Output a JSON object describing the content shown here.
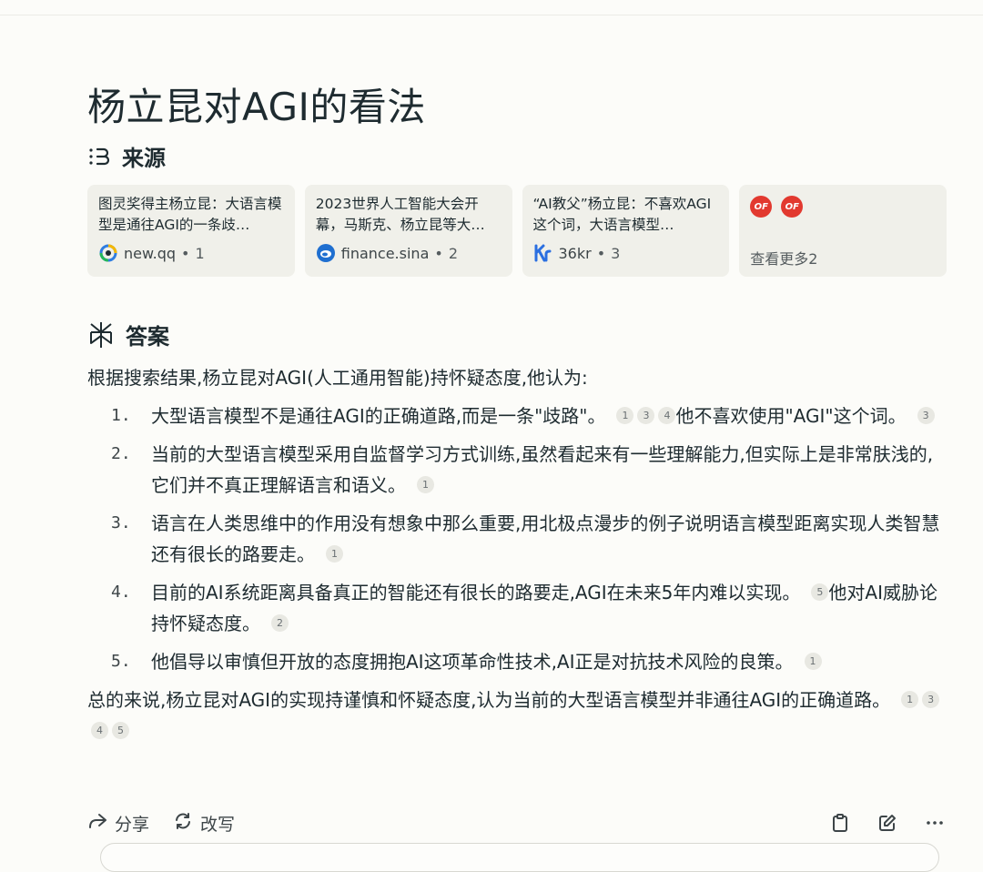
{
  "title": "杨立昆对AGI的看法",
  "sources": {
    "heading": "来源",
    "cards": [
      {
        "title": "图灵奖得主杨立昆：大语言模型是通往AGI的一条歧…",
        "domain": "new.qq",
        "index": "1",
        "icon": "qq-news-icon"
      },
      {
        "title": "2023世界人工智能大会开幕，马斯克、杨立昆等大…",
        "domain": "finance.sina",
        "index": "2",
        "icon": "sina-icon"
      },
      {
        "title": "“AI教父”杨立昆：不喜欢AGI这个词，大语言模型…",
        "domain": "36kr",
        "index": "3",
        "icon": "36kr-icon"
      }
    ],
    "more": {
      "label": "查看更多2",
      "icons": [
        "OF",
        "OF"
      ]
    }
  },
  "answer": {
    "heading": "答案",
    "intro": "根据搜索结果,杨立昆对AGI(人工通用智能)持怀疑态度,他认为:",
    "points": [
      {
        "num": "1.",
        "parts": [
          {
            "text": "大型语言模型不是通往AGI的正确道路,而是一条\"歧路\"。",
            "cites": [
              "1",
              "3",
              "4"
            ]
          },
          {
            "text": "他不喜欢使用\"AGI\"这个词。",
            "cites": [
              "3"
            ]
          }
        ]
      },
      {
        "num": "2.",
        "parts": [
          {
            "text": "当前的大型语言模型采用自监督学习方式训练,虽然看起来有一些理解能力,但实际上是非常肤浅的,它们并不真正理解语言和语义。",
            "cites": [
              "1"
            ]
          }
        ]
      },
      {
        "num": "3.",
        "parts": [
          {
            "text": "语言在人类思维中的作用没有想象中那么重要,用北极点漫步的例子说明语言模型距离实现人类智慧还有很长的路要走。",
            "cites": [
              "1"
            ]
          }
        ]
      },
      {
        "num": "4.",
        "parts": [
          {
            "text": "目前的AI系统距离具备真正的智能还有很长的路要走,AGI在未来5年内难以实现。",
            "cites": [
              "5"
            ]
          },
          {
            "text": "他对AI威胁论持怀疑态度。",
            "cites": [
              "2"
            ]
          }
        ]
      },
      {
        "num": "5.",
        "parts": [
          {
            "text": "他倡导以审慎但开放的态度拥抱AI这项革命性技术,AI正是对抗技术风险的良策。",
            "cites": [
              "1"
            ]
          }
        ]
      }
    ],
    "summary": {
      "text": "总的来说,杨立昆对AGI的实现持谨慎和怀疑态度,认为当前的大型语言模型并非通往AGI的正确道路。",
      "cites": [
        "1",
        "3",
        "4",
        "5"
      ]
    }
  },
  "actions": {
    "share": "分享",
    "rewrite": "改写"
  },
  "colors": {
    "background": "#fcfcf9",
    "card": "#f0f0ea",
    "text": "#1e2b30",
    "of_red": "#e2392f"
  }
}
